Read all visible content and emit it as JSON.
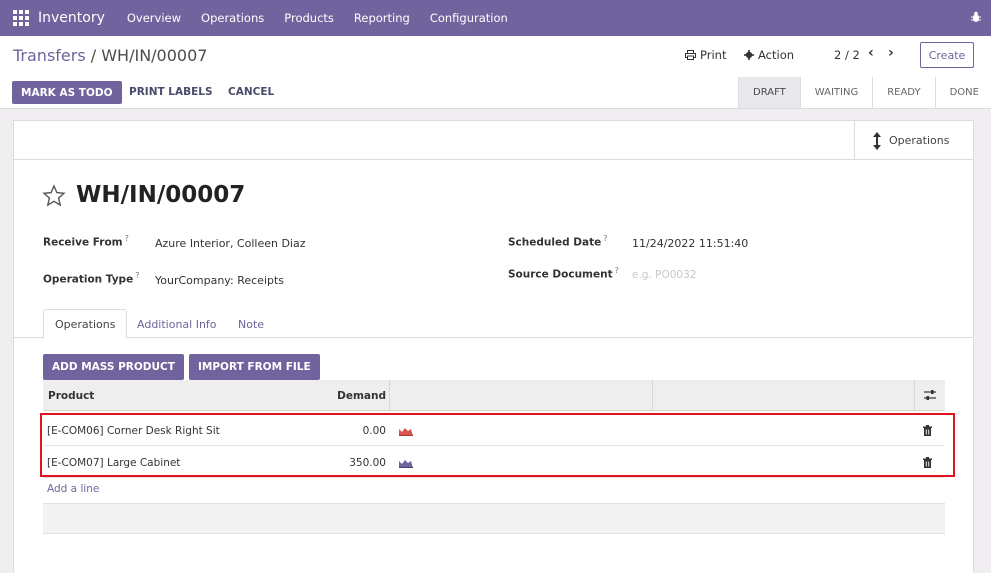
{
  "app": {
    "name": "Inventory"
  },
  "nav": {
    "items": [
      "Overview",
      "Operations",
      "Products",
      "Reporting",
      "Configuration"
    ]
  },
  "breadcrumb": {
    "parent": "Transfers",
    "sep": " / ",
    "current": "WH/IN/00007"
  },
  "toolbar": {
    "print": "Print",
    "action": "Action",
    "pager": "2 / 2",
    "create": "Create"
  },
  "actions": {
    "mark_todo": "MARK AS TODO",
    "print_labels": "PRINT LABELS",
    "cancel": "CANCEL"
  },
  "status": {
    "steps": [
      "DRAFT",
      "WAITING",
      "READY",
      "DONE"
    ],
    "active": "DRAFT"
  },
  "smart": {
    "operations": "Operations"
  },
  "record": {
    "name": "WH/IN/00007",
    "receive_from_label": "Receive From",
    "receive_from": "Azure Interior, Colleen Diaz",
    "operation_type_label": "Operation Type",
    "operation_type": "YourCompany: Receipts",
    "scheduled_date_label": "Scheduled Date",
    "scheduled_date": "11/24/2022 11:51:40",
    "source_document_label": "Source Document",
    "source_document_placeholder": "e.g. PO0032",
    "help_mark": "?"
  },
  "tabs": [
    "Operations",
    "Additional Info",
    "Note"
  ],
  "operations": {
    "add_mass": "ADD MASS PRODUCT",
    "import": "IMPORT FROM FILE",
    "columns": {
      "product": "Product",
      "demand": "Demand"
    },
    "rows": [
      {
        "product": "[E-COM06] Corner Desk Right Sit",
        "demand": "0.00",
        "chart_color": "#d9534f"
      },
      {
        "product": "[E-COM07] Large Cabinet",
        "demand": "350.00",
        "chart_color": "#71639e"
      }
    ],
    "add_line": "Add a line"
  },
  "colors": {
    "brand": "#71639e",
    "highlight": "#e0141e"
  }
}
